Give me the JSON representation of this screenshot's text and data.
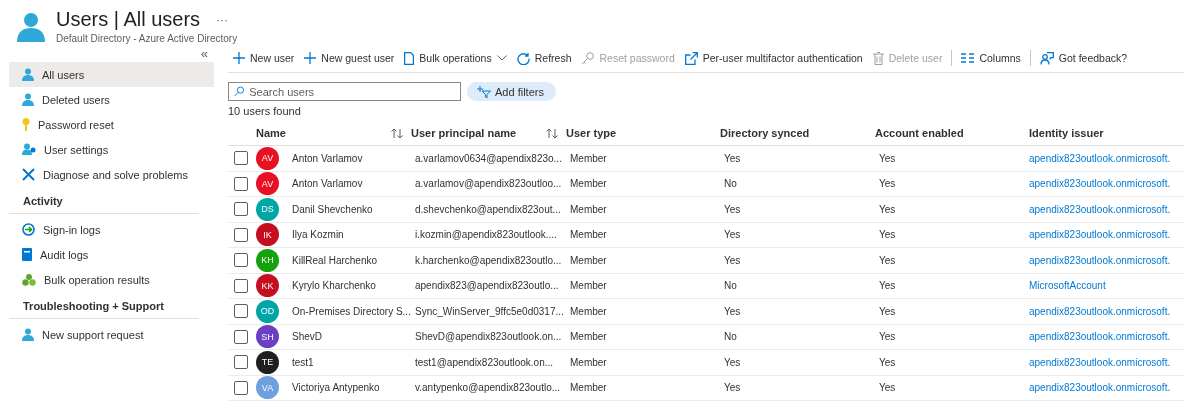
{
  "header": {
    "title": "Users | All users",
    "more": "···",
    "subtitle": "Default Directory - Azure Active Directory"
  },
  "sidebar": {
    "collapse": "«",
    "sections": [
      {
        "items": [
          {
            "label": "All users",
            "selected": true
          },
          {
            "label": "Deleted users",
            "selected": false
          },
          {
            "label": "Password reset",
            "selected": false
          },
          {
            "label": "User settings",
            "selected": false
          },
          {
            "label": "Diagnose and solve problems",
            "selected": false
          }
        ]
      },
      {
        "heading": "Activity",
        "items": [
          {
            "label": "Sign-in logs",
            "selected": false
          },
          {
            "label": "Audit logs",
            "selected": false
          },
          {
            "label": "Bulk operation results",
            "selected": false
          }
        ]
      },
      {
        "heading": "Troubleshooting + Support",
        "items": [
          {
            "label": "New support request",
            "selected": false
          }
        ]
      }
    ]
  },
  "toolbar_groups": [
    {
      "items": [
        {
          "label": "New user",
          "disabled": false
        },
        {
          "label": "New guest user",
          "disabled": false
        },
        {
          "label": "Bulk operations",
          "disabled": false,
          "dropdown": true
        },
        {
          "label": "Refresh",
          "disabled": false
        },
        {
          "label": "Reset password",
          "disabled": true
        },
        {
          "label": "Per-user multifactor authentication",
          "disabled": false
        },
        {
          "label": "Delete user",
          "disabled": true
        }
      ]
    },
    {
      "items": [
        {
          "label": "Columns",
          "disabled": false
        }
      ]
    },
    {
      "items": [
        {
          "label": "Got feedback?",
          "disabled": false
        }
      ]
    }
  ],
  "search": {
    "placeholder": "Search users"
  },
  "add_filters": "Add filters",
  "result_count": "10 users found",
  "table": {
    "columns": [
      {
        "label": "Name",
        "sortable": true
      },
      {
        "label": "User principal name",
        "sortable": true
      },
      {
        "label": "User type",
        "sortable": false
      },
      {
        "label": "Directory synced",
        "sortable": false
      },
      {
        "label": "Account enabled",
        "sortable": false
      },
      {
        "label": "Identity issuer",
        "sortable": false
      }
    ],
    "rows": [
      {
        "checked": false,
        "initials": "AV",
        "color": "#e81123",
        "cells": [
          "Anton Varlamov",
          "a.varlamov0634@apendix823o...",
          "Member",
          "Yes",
          "Yes",
          "apendix823outlook.onmicrosoft."
        ]
      },
      {
        "checked": false,
        "initials": "AV",
        "color": "#e81123",
        "cells": [
          "Anton Varlamov",
          "a.varlamov@apendix823outloo...",
          "Member",
          "No",
          "Yes",
          "apendix823outlook.onmicrosoft."
        ]
      },
      {
        "checked": false,
        "initials": "DS",
        "color": "#00a6a6",
        "cells": [
          "Danil Shevchenko",
          "d.shevchenko@apendix823out...",
          "Member",
          "Yes",
          "Yes",
          "apendix823outlook.onmicrosoft."
        ]
      },
      {
        "checked": false,
        "initials": "IK",
        "color": "#c50f1f",
        "cells": [
          "Ilya Kozmin",
          "i.kozmin@apendix823outlook....",
          "Member",
          "Yes",
          "Yes",
          "apendix823outlook.onmicrosoft."
        ]
      },
      {
        "checked": false,
        "initials": "KH",
        "color": "#13a10e",
        "cells": [
          "KillReal Harchenko",
          "k.harchenko@apendix823outlo...",
          "Member",
          "Yes",
          "Yes",
          "apendix823outlook.onmicrosoft."
        ]
      },
      {
        "checked": false,
        "initials": "KK",
        "color": "#c50f1f",
        "cells": [
          "Kyrylo Kharchenko",
          "apendix823@apendix823outlo...",
          "Member",
          "No",
          "Yes",
          "MicrosoftAccount"
        ]
      },
      {
        "checked": false,
        "initials": "OD",
        "color": "#00a6a6",
        "cells": [
          "On-Premises Directory S...",
          "Sync_WinServer_9ffc5e0d0317...",
          "Member",
          "Yes",
          "Yes",
          "apendix823outlook.onmicrosoft."
        ]
      },
      {
        "checked": false,
        "initials": "SH",
        "color": "#6b3fc4",
        "cells": [
          "ShevD",
          "ShevD@apendix823outlook.on...",
          "Member",
          "No",
          "Yes",
          "apendix823outlook.onmicrosoft."
        ]
      },
      {
        "checked": false,
        "initials": "TE",
        "color": "#1f1f1f",
        "cells": [
          "test1",
          "test1@apendix823outlook.on...",
          "Member",
          "Yes",
          "Yes",
          "apendix823outlook.onmicrosoft."
        ]
      },
      {
        "checked": false,
        "initials": "VA",
        "color": "#6ca0e0",
        "cells": [
          "Victoriya Antypenko",
          "v.antypenko@apendix823outlo...",
          "Member",
          "Yes",
          "Yes",
          "apendix823outlook.onmicrosoft."
        ]
      }
    ]
  }
}
